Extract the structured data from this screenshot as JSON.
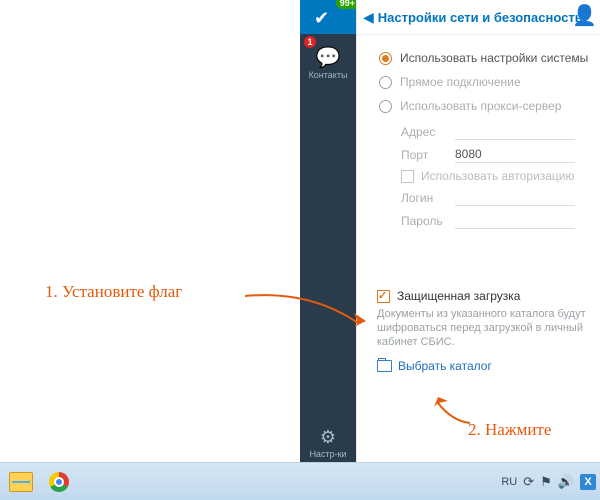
{
  "sidebar": {
    "badge": "99+",
    "alert": "1",
    "contacts": {
      "icon": "💬",
      "label": "Контакты"
    },
    "settings": {
      "icon": "⚙",
      "label": "Настр-ки"
    }
  },
  "panel": {
    "title": "Настройки сети и безопасность",
    "opt_system": "Использовать настройки системы",
    "opt_direct": "Прямое подключение",
    "opt_proxy": "Использовать прокси-сервер",
    "addr_label": "Адрес",
    "addr_value": "",
    "port_label": "Порт",
    "port_value": "8080",
    "auth_label": "Использовать авторизацию",
    "login_label": "Логин",
    "login_value": "",
    "pass_label": "Пароль",
    "pass_value": "",
    "secure_label": "Защищенная загрузка",
    "secure_desc": "Документы из указанного каталога будут шифроваться перед загрузкой в личный кабинет СБИС.",
    "choose_label": "Выбрать каталог"
  },
  "ann": {
    "step1": "1. Установите флаг",
    "step2": "2. Нажмите"
  },
  "taskbar": {
    "lang": "RU"
  }
}
